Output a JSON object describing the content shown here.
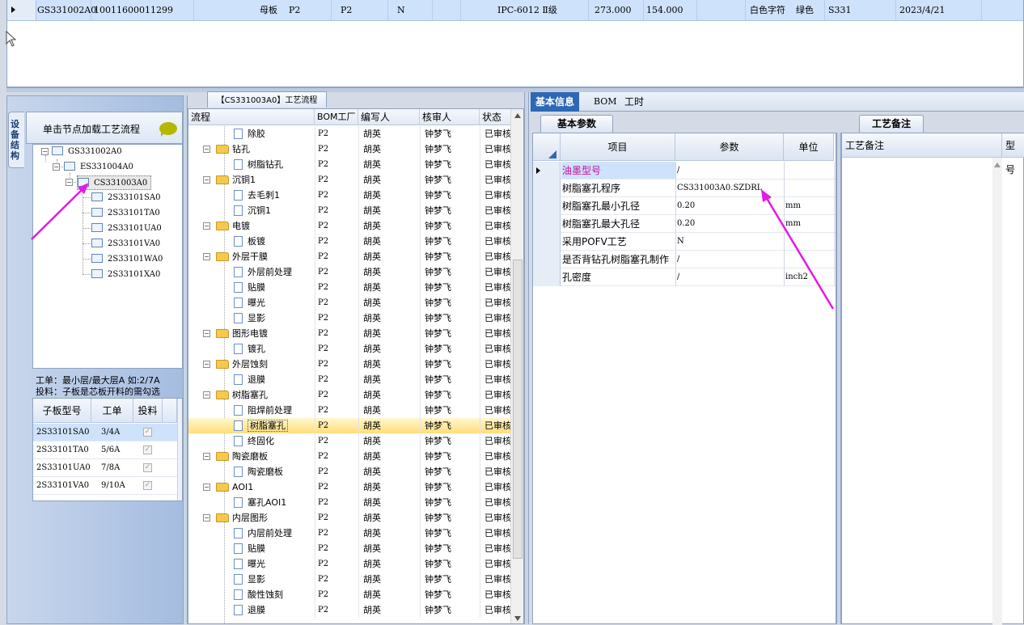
{
  "top_grid": {
    "cells": [
      "GS331002A0",
      "10011600011299",
      "母板",
      "P2",
      "P2",
      "N",
      "IPC-6012 Ⅱ级",
      "273.000",
      "154.000",
      "白色字符",
      "绿色",
      "S331",
      "2023/4/21"
    ]
  },
  "left": {
    "vertical_tab": "设备结构",
    "load_header": "单击节点加载工艺流程",
    "tree": [
      {
        "label": "GS331002A0"
      },
      {
        "label": "ES331004A0"
      },
      {
        "label": "CS331003A0"
      },
      {
        "label": "2S33101SA0"
      },
      {
        "label": "2S33101TA0"
      },
      {
        "label": "2S33101UA0"
      },
      {
        "label": "2S33101VA0"
      },
      {
        "label": "2S33101WA0"
      },
      {
        "label": "2S33101XA0"
      }
    ],
    "info_line1": "工单：最小层/最大层A 如:2/7A",
    "info_line2": "投料：子板是芯板开料的需勾选",
    "sub_grid": {
      "headers": [
        "子板型号",
        "工单",
        "投料"
      ],
      "rows": [
        {
          "model": "2S33101SA0",
          "order": "3/4A",
          "feed": true
        },
        {
          "model": "2S33101TA0",
          "order": "5/6A",
          "feed": true
        },
        {
          "model": "2S33101UA0",
          "order": "7/8A",
          "feed": true
        },
        {
          "model": "2S33101VA0",
          "order": "9/10A",
          "feed": true
        }
      ]
    }
  },
  "process": {
    "tab_label": "【CS331003A0】工艺流程",
    "headers": [
      "流程",
      "BOM工厂",
      "编写人",
      "核审人",
      "状态"
    ],
    "rows": [
      {
        "name": "除胶",
        "kind": "step",
        "factory": "P2",
        "writer": "胡英",
        "reviewer": "钟梦飞",
        "status": "已审核"
      },
      {
        "name": "钻孔",
        "kind": "folder",
        "factory": "P2",
        "writer": "胡英",
        "reviewer": "钟梦飞",
        "status": "已审核"
      },
      {
        "name": "树脂钻孔",
        "kind": "step",
        "factory": "P2",
        "writer": "胡英",
        "reviewer": "钟梦飞",
        "status": "已审核"
      },
      {
        "name": "沉铜1",
        "kind": "folder",
        "factory": "P2",
        "writer": "胡英",
        "reviewer": "钟梦飞",
        "status": "已审核"
      },
      {
        "name": "去毛刺1",
        "kind": "step",
        "factory": "P2",
        "writer": "胡英",
        "reviewer": "钟梦飞",
        "status": "已审核"
      },
      {
        "name": "沉铜1",
        "kind": "step",
        "factory": "P2",
        "writer": "胡英",
        "reviewer": "钟梦飞",
        "status": "已审核"
      },
      {
        "name": "电镀",
        "kind": "folder",
        "factory": "P2",
        "writer": "胡英",
        "reviewer": "钟梦飞",
        "status": "已审核"
      },
      {
        "name": "板镀",
        "kind": "step",
        "factory": "P2",
        "writer": "胡英",
        "reviewer": "钟梦飞",
        "status": "已审核"
      },
      {
        "name": "外层干膜",
        "kind": "folder",
        "factory": "P2",
        "writer": "胡英",
        "reviewer": "钟梦飞",
        "status": "已审核"
      },
      {
        "name": "外层前处理",
        "kind": "step",
        "factory": "P2",
        "writer": "胡英",
        "reviewer": "钟梦飞",
        "status": "已审核"
      },
      {
        "name": "贴膜",
        "kind": "step",
        "factory": "P2",
        "writer": "胡英",
        "reviewer": "钟梦飞",
        "status": "已审核"
      },
      {
        "name": "曝光",
        "kind": "step",
        "factory": "P2",
        "writer": "胡英",
        "reviewer": "钟梦飞",
        "status": "已审核"
      },
      {
        "name": "显影",
        "kind": "step",
        "factory": "P2",
        "writer": "胡英",
        "reviewer": "钟梦飞",
        "status": "已审核"
      },
      {
        "name": "图形电镀",
        "kind": "folder",
        "factory": "P2",
        "writer": "胡英",
        "reviewer": "钟梦飞",
        "status": "已审核"
      },
      {
        "name": "镀孔",
        "kind": "step",
        "factory": "P2",
        "writer": "胡英",
        "reviewer": "钟梦飞",
        "status": "已审核"
      },
      {
        "name": "外层蚀刻",
        "kind": "folder",
        "factory": "P2",
        "writer": "胡英",
        "reviewer": "钟梦飞",
        "status": "已审核"
      },
      {
        "name": "退膜",
        "kind": "step",
        "factory": "P2",
        "writer": "胡英",
        "reviewer": "钟梦飞",
        "status": "已审核"
      },
      {
        "name": "树脂塞孔",
        "kind": "folder",
        "factory": "P2",
        "writer": "胡英",
        "reviewer": "钟梦飞",
        "status": "已审核"
      },
      {
        "name": "阻焊前处理",
        "kind": "step",
        "factory": "P2",
        "writer": "胡英",
        "reviewer": "钟梦飞",
        "status": "已审核"
      },
      {
        "name": "树脂塞孔",
        "kind": "step",
        "factory": "P2",
        "writer": "胡英",
        "reviewer": "钟梦飞",
        "status": "已审核",
        "selected": true
      },
      {
        "name": "终固化",
        "kind": "step",
        "factory": "P2",
        "writer": "胡英",
        "reviewer": "钟梦飞",
        "status": "已审核"
      },
      {
        "name": "陶瓷磨板",
        "kind": "folder",
        "factory": "P2",
        "writer": "胡英",
        "reviewer": "钟梦飞",
        "status": "已审核"
      },
      {
        "name": "陶瓷磨板",
        "kind": "step",
        "factory": "P2",
        "writer": "胡英",
        "reviewer": "钟梦飞",
        "status": "已审核"
      },
      {
        "name": "AOI1",
        "kind": "folder",
        "factory": "P2",
        "writer": "胡英",
        "reviewer": "钟梦飞",
        "status": "已审核"
      },
      {
        "name": "塞孔AOI1",
        "kind": "step",
        "factory": "P2",
        "writer": "胡英",
        "reviewer": "钟梦飞",
        "status": "已审核"
      },
      {
        "name": "内层图形",
        "kind": "folder",
        "factory": "P2",
        "writer": "胡英",
        "reviewer": "钟梦飞",
        "status": "已审核"
      },
      {
        "name": "内层前处理",
        "kind": "step",
        "factory": "P2",
        "writer": "胡英",
        "reviewer": "钟梦飞",
        "status": "已审核"
      },
      {
        "name": "贴膜",
        "kind": "step",
        "factory": "P2",
        "writer": "胡英",
        "reviewer": "钟梦飞",
        "status": "已审核"
      },
      {
        "name": "曝光",
        "kind": "step",
        "factory": "P2",
        "writer": "胡英",
        "reviewer": "钟梦飞",
        "status": "已审核"
      },
      {
        "name": "显影",
        "kind": "step",
        "factory": "P2",
        "writer": "胡英",
        "reviewer": "钟梦飞",
        "status": "已审核"
      },
      {
        "name": "酸性蚀刻",
        "kind": "step",
        "factory": "P2",
        "writer": "胡英",
        "reviewer": "钟梦飞",
        "status": "已审核"
      },
      {
        "name": "退膜",
        "kind": "step",
        "factory": "P2",
        "writer": "胡英",
        "reviewer": "钟梦飞",
        "status": "已审核"
      }
    ]
  },
  "right": {
    "tabs": [
      "基本信息",
      "BOM",
      "工时"
    ],
    "sub_tab_params": "基本参数",
    "sub_tab_notes": "工艺备注",
    "param_headers": [
      "项目",
      "参数",
      "单位"
    ],
    "params": [
      {
        "item": "油墨型号",
        "value": "/",
        "unit": "",
        "highlight": true
      },
      {
        "item": "树脂塞孔程序",
        "value": "CS331003A0.SZDRL",
        "unit": ""
      },
      {
        "item": "树脂塞孔最小孔径",
        "value": "0.20",
        "unit": "mm"
      },
      {
        "item": "树脂塞孔最大孔径",
        "value": "0.20",
        "unit": "mm"
      },
      {
        "item": "采用POFV工艺",
        "value": "N",
        "unit": ""
      },
      {
        "item": "是否背钻孔树脂塞孔制作",
        "value": "/",
        "unit": ""
      },
      {
        "item": "孔密度",
        "value": "/",
        "unit": "inch2"
      }
    ],
    "note_headers": [
      "工艺备注",
      "型号"
    ]
  },
  "colors": {
    "accent": "#2e67b4",
    "annotation_arrow": "#e619e6",
    "selected_row": "#ffde7a",
    "highlight_text": "#c0129a"
  }
}
